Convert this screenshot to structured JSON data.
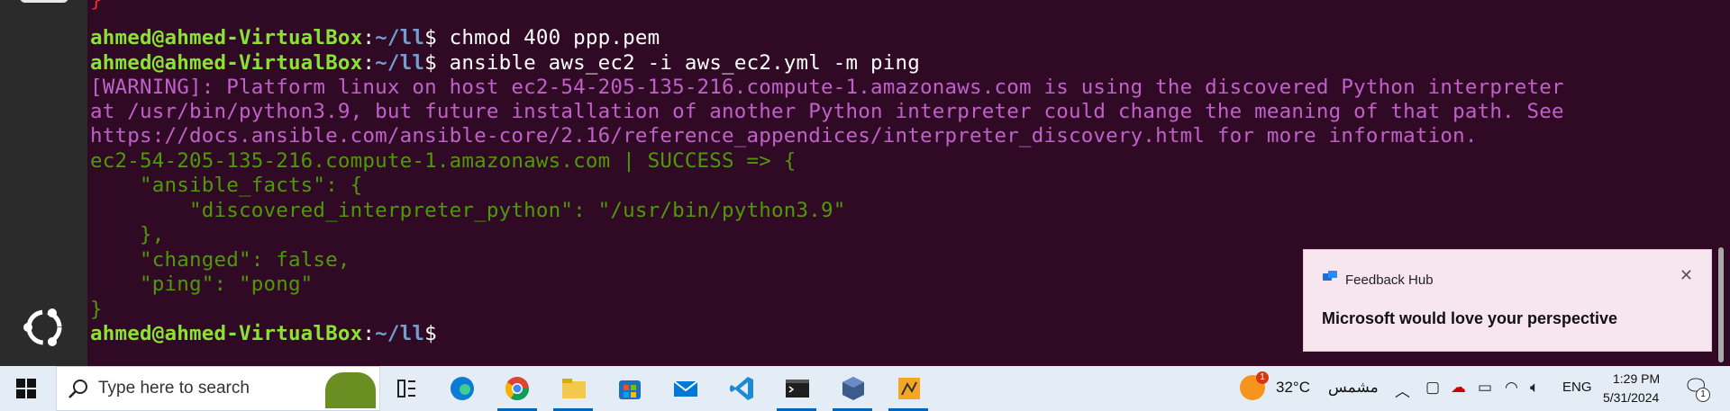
{
  "terminal": {
    "lines": [
      {
        "segments": [
          {
            "text": "}",
            "cls": "red"
          }
        ]
      },
      {
        "segments": [
          {
            "text": "ahmed@ahmed-VirtualBox",
            "cls": "user"
          },
          {
            "text": ":",
            "cls": ""
          },
          {
            "text": "~/ll",
            "cls": "path"
          },
          {
            "text": "$ chmod 400 ppp.pem",
            "cls": ""
          }
        ]
      },
      {
        "segments": [
          {
            "text": "ahmed@ahmed-VirtualBox",
            "cls": "user"
          },
          {
            "text": ":",
            "cls": ""
          },
          {
            "text": "~/ll",
            "cls": "path"
          },
          {
            "text": "$ ansible aws_ec2 -i aws_ec2.yml -m ping",
            "cls": ""
          }
        ]
      },
      {
        "segments": [
          {
            "text": "[WARNING]: Platform linux on host ec2-54-205-135-216.compute-1.amazonaws.com is using the discovered Python interpreter",
            "cls": "warn"
          }
        ]
      },
      {
        "segments": [
          {
            "text": "at /usr/bin/python3.9, but future installation of another Python interpreter could change the meaning of that path. See",
            "cls": "warn"
          }
        ]
      },
      {
        "segments": [
          {
            "text": "https://docs.ansible.com/ansible-core/2.16/reference_appendices/interpreter_discovery.html for more information.",
            "cls": "warn"
          }
        ]
      },
      {
        "segments": [
          {
            "text": "ec2-54-205-135-216.compute-1.amazonaws.com | SUCCESS => {",
            "cls": "ok"
          }
        ]
      },
      {
        "segments": [
          {
            "text": "    \"ansible_facts\": {",
            "cls": "ok"
          }
        ]
      },
      {
        "segments": [
          {
            "text": "        \"discovered_interpreter_python\": \"/usr/bin/python3.9\"",
            "cls": "ok"
          }
        ]
      },
      {
        "segments": [
          {
            "text": "    },",
            "cls": "ok"
          }
        ]
      },
      {
        "segments": [
          {
            "text": "    \"changed\": false,",
            "cls": "ok"
          }
        ]
      },
      {
        "segments": [
          {
            "text": "    \"ping\": \"pong\"",
            "cls": "ok"
          }
        ]
      },
      {
        "segments": [
          {
            "text": "}",
            "cls": "ok"
          }
        ]
      },
      {
        "segments": [
          {
            "text": "ahmed@ahmed-VirtualBox",
            "cls": "user"
          },
          {
            "text": ":",
            "cls": ""
          },
          {
            "text": "~/ll",
            "cls": "path"
          },
          {
            "text": "$ ",
            "cls": ""
          }
        ]
      }
    ]
  },
  "toast": {
    "app_name": "Feedback Hub",
    "message": "Microsoft would love your perspective",
    "close_icon": "close-icon"
  },
  "taskbar": {
    "search_placeholder": "Type here to search",
    "weather_temp": "32°C",
    "weather_desc": "مشمس",
    "weather_badge": "1",
    "language": "ENG",
    "time": "1:29 PM",
    "date": "5/31/2024",
    "notification_count": "1",
    "pinned_apps": [
      "task-view-icon",
      "edge-icon",
      "chrome-icon",
      "file-explorer-icon",
      "store-icon",
      "mail-icon",
      "vscode-icon",
      "terminal-icon",
      "virtualbox-icon",
      "app-icon"
    ]
  },
  "colors": {
    "terminal_bg": "#300a24",
    "user": "#8ae234",
    "path": "#729fcf",
    "warning": "#c061cb",
    "success": "#4e9a06",
    "accent": "#0067c0"
  }
}
